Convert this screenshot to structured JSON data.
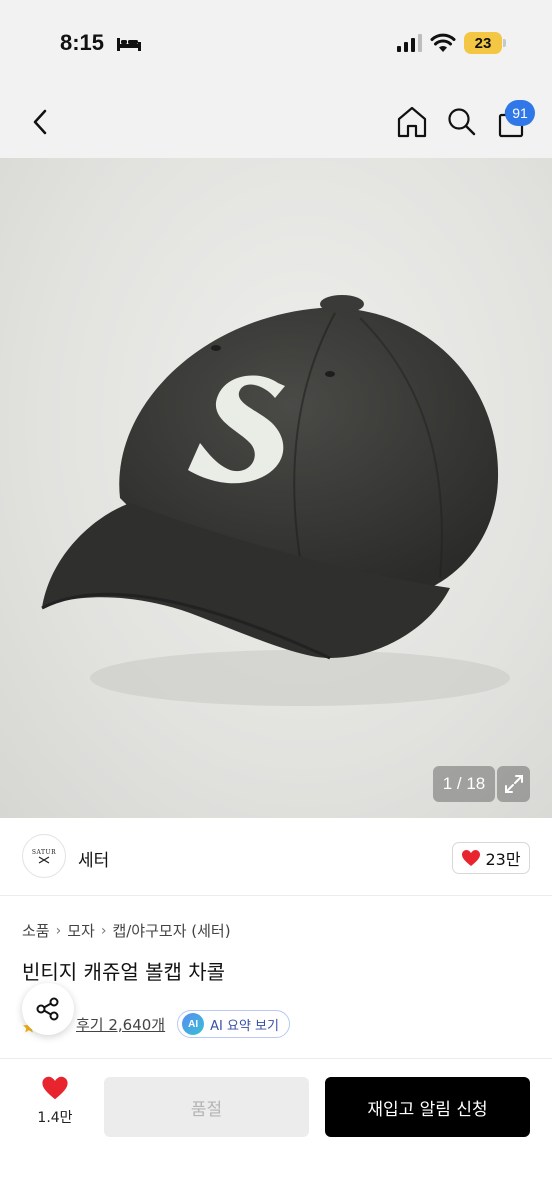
{
  "status_bar": {
    "time": "8:15",
    "battery": "23"
  },
  "nav": {
    "cart_count": "91"
  },
  "gallery": {
    "counter": "1 / 18",
    "current": 1,
    "total": 18
  },
  "brand": {
    "logo_text": "SATUR",
    "name": "세터",
    "likes": "23만"
  },
  "breadcrumb": [
    "소품",
    "모자",
    "캡/야구모자 (세터)"
  ],
  "product": {
    "title": "빈티지 캐쥬얼 볼캡 차콜",
    "reviews_label": "후기 2,640개",
    "ai_badge": "AI",
    "ai_summary_label": "AI 요약 보기"
  },
  "bottom_bar": {
    "wishlist_count": "1.4만",
    "sold_out_label": "품절",
    "restock_label": "재입고 알림 신청"
  },
  "colors": {
    "accent_blue": "#3078e8",
    "heart_red": "#e8242f",
    "battery_yellow": "#f3c744"
  }
}
